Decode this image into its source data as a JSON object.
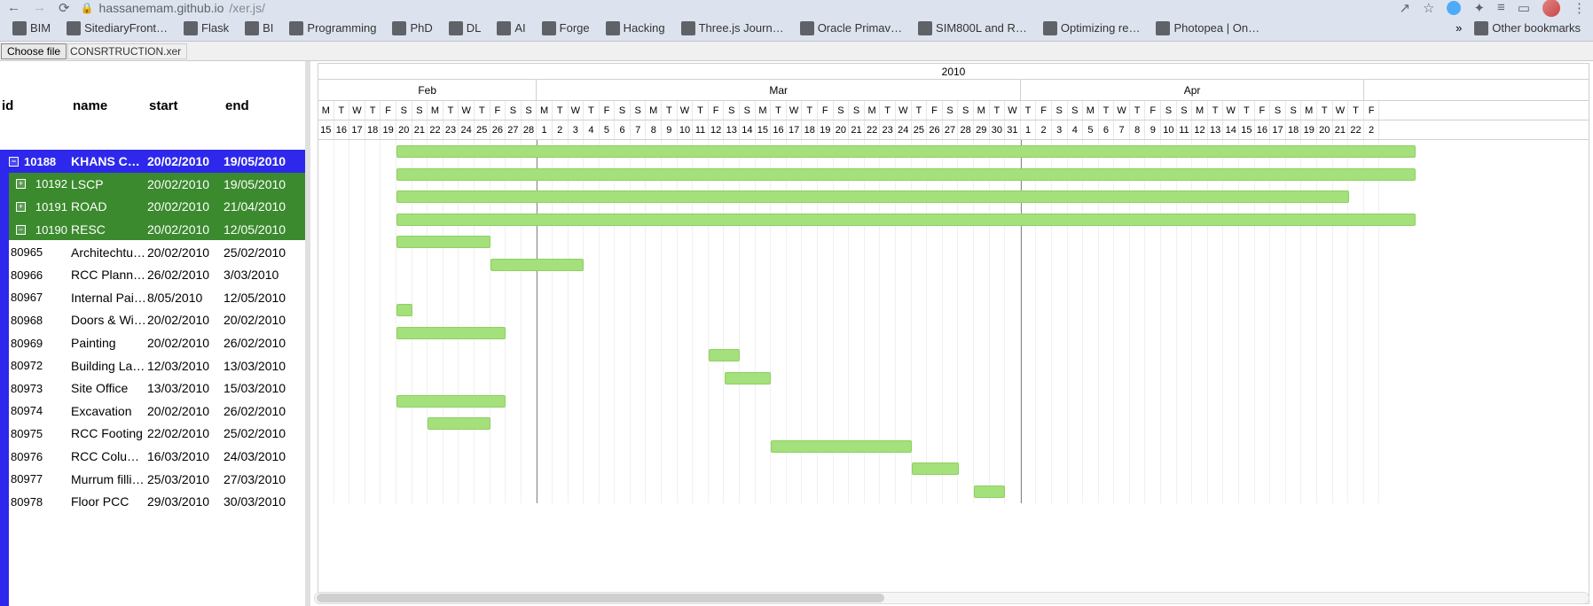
{
  "browser": {
    "url_host": "hassanemam.github.io",
    "url_path": "/xer.js/",
    "back_icon": "←",
    "fwd_icon": "→",
    "reload_icon": "⟳",
    "share_icon": "↗",
    "star_icon": "☆",
    "ext_icon": "✦",
    "puzzle_icon": "✦",
    "menu_icon": "≡",
    "dots_icon": "⋮",
    "chevrons": "»",
    "other_bookmarks": "Other bookmarks"
  },
  "bookmarks": [
    {
      "label": "BIM"
    },
    {
      "label": "SitediaryFront…"
    },
    {
      "label": "Flask"
    },
    {
      "label": "BI"
    },
    {
      "label": "Programming"
    },
    {
      "label": "PhD"
    },
    {
      "label": "DL"
    },
    {
      "label": "AI"
    },
    {
      "label": "Forge"
    },
    {
      "label": "Hacking"
    },
    {
      "label": "Three.js Journ…"
    },
    {
      "label": "Oracle Primav…"
    },
    {
      "label": "SIM800L and R…"
    },
    {
      "label": "Optimizing re…"
    },
    {
      "label": "Photopea | On…"
    }
  ],
  "file": {
    "choose_label": "Choose file",
    "name": "CONSRTRUCTION.xer"
  },
  "columns": {
    "id": "id",
    "name": "name",
    "start": "start",
    "end": "end"
  },
  "year": "2010",
  "months": [
    {
      "label": "Feb",
      "days": 14
    },
    {
      "label": "Mar",
      "days": 31
    },
    {
      "label": "Apr",
      "days": 22
    }
  ],
  "day_letters": [
    "M",
    "T",
    "W",
    "T",
    "F",
    "S",
    "S",
    "M",
    "T",
    "W",
    "T",
    "F",
    "S",
    "S",
    "M",
    "T",
    "W",
    "T",
    "F",
    "S",
    "S",
    "M",
    "T",
    "W",
    "T",
    "F",
    "S",
    "S",
    "M",
    "T",
    "W",
    "T",
    "F",
    "S",
    "S",
    "M",
    "T",
    "W",
    "T",
    "F",
    "S",
    "S",
    "M",
    "T",
    "W",
    "T",
    "F",
    "S",
    "S",
    "M",
    "T",
    "W",
    "T",
    "F",
    "S",
    "S",
    "M",
    "T",
    "W",
    "T",
    "F",
    "S",
    "S",
    "M",
    "T",
    "W",
    "T",
    "F"
  ],
  "day_nums": [
    "15",
    "16",
    "17",
    "18",
    "19",
    "20",
    "21",
    "22",
    "23",
    "24",
    "25",
    "26",
    "27",
    "28",
    "1",
    "2",
    "3",
    "4",
    "5",
    "6",
    "7",
    "8",
    "9",
    "10",
    "11",
    "12",
    "13",
    "14",
    "15",
    "16",
    "17",
    "18",
    "19",
    "20",
    "21",
    "22",
    "23",
    "24",
    "25",
    "26",
    "27",
    "28",
    "29",
    "30",
    "31",
    "1",
    "2",
    "3",
    "4",
    "5",
    "6",
    "7",
    "8",
    "9",
    "10",
    "11",
    "12",
    "13",
    "14",
    "15",
    "16",
    "17",
    "18",
    "19",
    "20",
    "21",
    "22",
    "2"
  ],
  "tasks": [
    {
      "id": "10188",
      "name": "KHANS CONS",
      "start": "20/02/2010",
      "end": "19/05/2010",
      "type": "selected",
      "exp": "⊟",
      "lvl": 0,
      "bs": 5,
      "be": 93
    },
    {
      "id": "10192",
      "name": "LSCP",
      "start": "20/02/2010",
      "end": "19/05/2010",
      "type": "wbs",
      "exp": "⊞",
      "lvl": 1,
      "bs": 5,
      "be": 93
    },
    {
      "id": "10191",
      "name": "ROAD",
      "start": "20/02/2010",
      "end": "21/04/2010",
      "type": "wbs",
      "exp": "⊞",
      "lvl": 1,
      "bs": 5,
      "be": 65
    },
    {
      "id": "10190",
      "name": "RESC",
      "start": "20/02/2010",
      "end": "12/05/2010",
      "type": "wbs",
      "exp": "⊟",
      "lvl": 1,
      "bs": 5,
      "be": 86
    },
    {
      "id": "80965",
      "name": "Architechtur…",
      "start": "20/02/2010",
      "end": "25/02/2010",
      "type": "task",
      "bs": 5,
      "be": 10
    },
    {
      "id": "80966",
      "name": "RCC Planni…",
      "start": "26/02/2010",
      "end": "3/03/2010",
      "type": "task",
      "bs": 11,
      "be": 16
    },
    {
      "id": "80967",
      "name": "Internal Pain…",
      "start": "8/05/2010",
      "end": "12/05/2010",
      "type": "task",
      "bs": 82,
      "be": 86
    },
    {
      "id": "80968",
      "name": "Doors & Wi…",
      "start": "20/02/2010",
      "end": "20/02/2010",
      "type": "task",
      "bs": 5,
      "be": 5
    },
    {
      "id": "80969",
      "name": "Painting",
      "start": "20/02/2010",
      "end": "26/02/2010",
      "type": "task",
      "bs": 5,
      "be": 11
    },
    {
      "id": "80972",
      "name": "Building La…",
      "start": "12/03/2010",
      "end": "13/03/2010",
      "type": "task",
      "bs": 25,
      "be": 26
    },
    {
      "id": "80973",
      "name": "Site Office",
      "start": "13/03/2010",
      "end": "15/03/2010",
      "type": "task",
      "bs": 26,
      "be": 28
    },
    {
      "id": "80974",
      "name": "Excavation",
      "start": "20/02/2010",
      "end": "26/02/2010",
      "type": "task",
      "bs": 5,
      "be": 11
    },
    {
      "id": "80975",
      "name": "RCC Footing",
      "start": "22/02/2010",
      "end": "25/02/2010",
      "type": "task",
      "bs": 7,
      "be": 10
    },
    {
      "id": "80976",
      "name": "RCC Colum…",
      "start": "16/03/2010",
      "end": "24/03/2010",
      "type": "task",
      "bs": 29,
      "be": 37
    },
    {
      "id": "80977",
      "name": "Murrum filli…",
      "start": "25/03/2010",
      "end": "27/03/2010",
      "type": "task",
      "bs": 38,
      "be": 40
    },
    {
      "id": "80978",
      "name": "Floor PCC",
      "start": "29/03/2010",
      "end": "30/03/2010",
      "type": "task",
      "bs": 42,
      "be": 43
    }
  ]
}
